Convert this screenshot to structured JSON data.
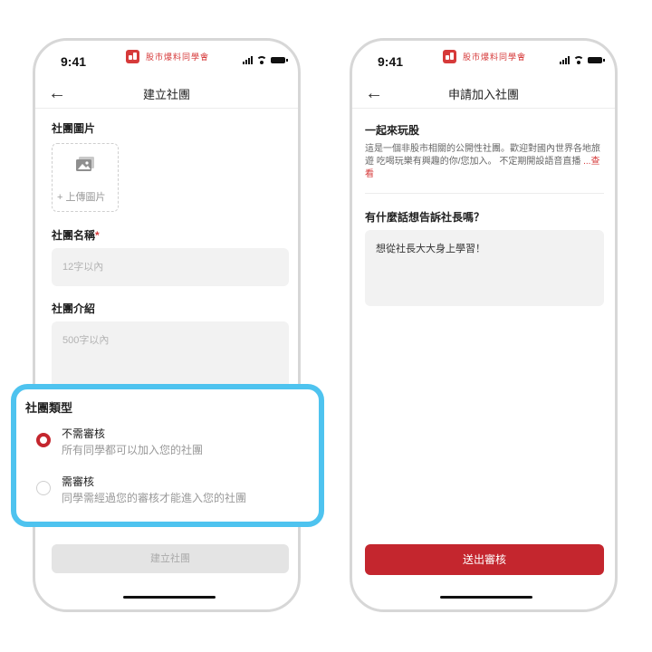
{
  "status_bar": {
    "time": "9:41",
    "app_name": "股市爆料同學會"
  },
  "create_screen": {
    "nav_title": "建立社團",
    "photo_label": "社團圖片",
    "upload_label": "+ 上傳圖片",
    "name_label": "社團名稱",
    "required_mark": "*",
    "name_placeholder": "12字以內",
    "intro_label": "社團介紹",
    "intro_placeholder": "500字以內",
    "submit_label": "建立社團"
  },
  "type_panel": {
    "title": "社團類型",
    "options": [
      {
        "title": "不需審核",
        "desc": "所有同學都可以加入您的社團",
        "selected": true
      },
      {
        "title": "需審核",
        "desc": "同學需經過您的審核才能進入您的社團",
        "selected": false
      }
    ]
  },
  "join_screen": {
    "nav_title": "申請加入社團",
    "group_name": "一起來玩股",
    "group_desc": "這是一個非股市相關的公開性社團。歡迎對國內世界各地旅遊 吃喝玩樂有興趣的你/您加入。 不定期開設語音直播",
    "more_link": "...查看",
    "question_label": "有什麼話想告訴社長嗎？",
    "message": "想從社長大大身上學習！",
    "submit_label": "送出審核"
  },
  "colors": {
    "accent_red": "#c4262e",
    "highlight_blue": "#4ec3ef",
    "input_gray": "#f2f2f2"
  },
  "icons": [
    "back-arrow-icon",
    "image-icon",
    "signal-icon",
    "wifi-icon",
    "battery-icon",
    "app-logo-icon"
  ]
}
